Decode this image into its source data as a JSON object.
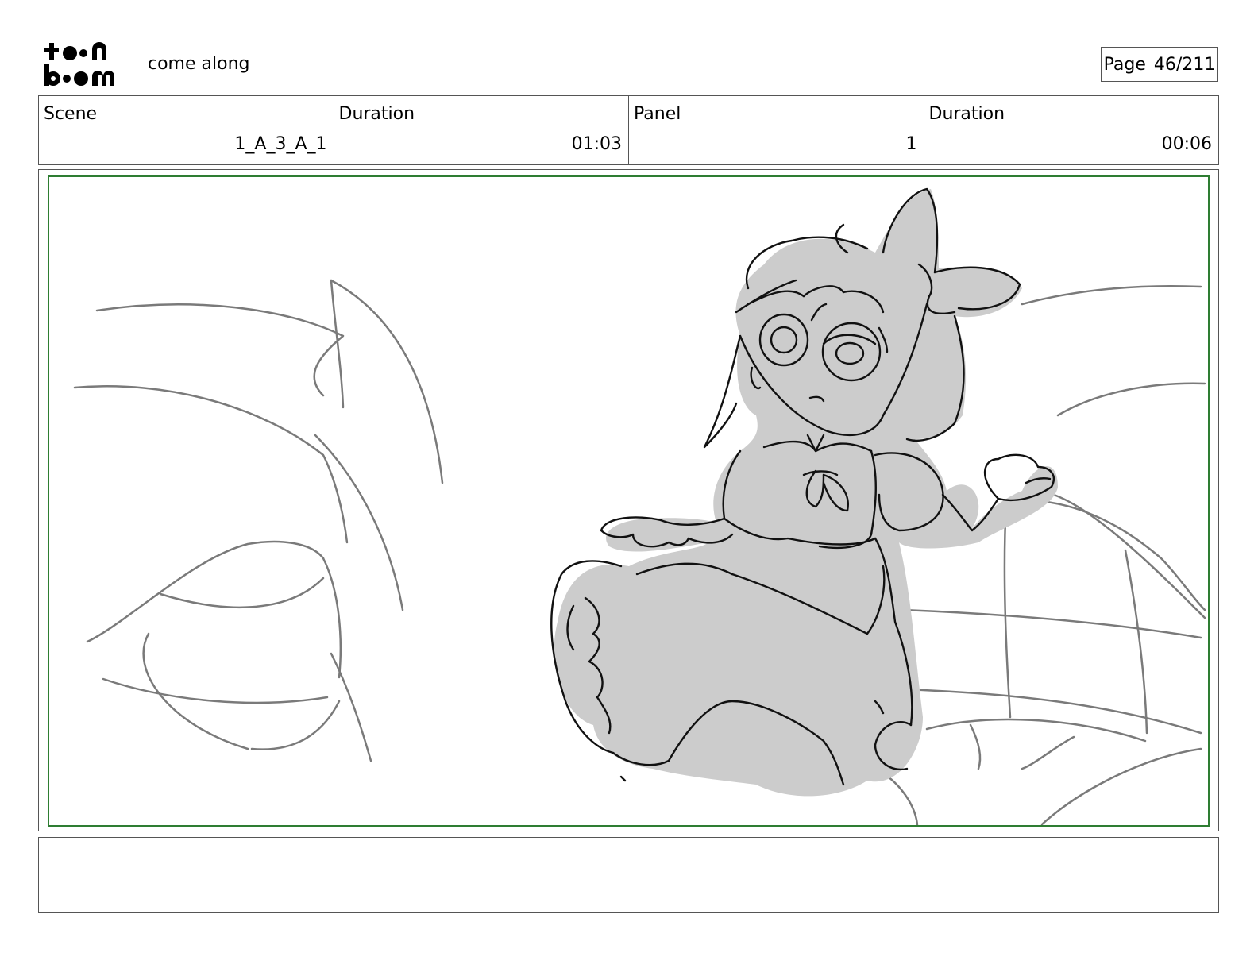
{
  "header": {
    "logo_text": "toon boom",
    "project_title": "come along",
    "page_label": "Page",
    "page_value": "46/211"
  },
  "info": {
    "scene_label": "Scene",
    "scene_value": "1_A_3_A_1",
    "scene_duration_label": "Duration",
    "scene_duration_value": "01:03",
    "panel_label": "Panel",
    "panel_value": "1",
    "panel_duration_label": "Duration",
    "panel_duration_value": "00:06"
  },
  "panel": {
    "image_semantic": "storyboard-sketch",
    "safe_frame_color": "#2e7d32",
    "fill_color": "#cccccc"
  },
  "notes": {
    "text": ""
  }
}
